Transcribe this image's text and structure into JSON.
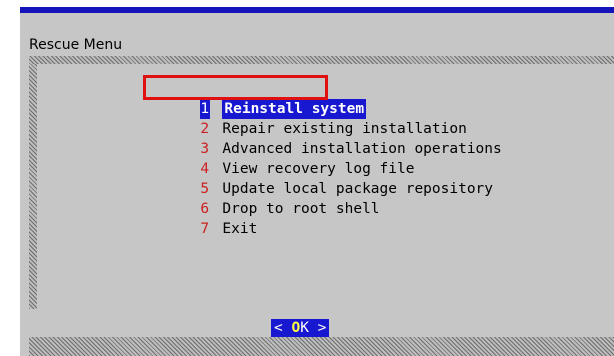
{
  "dialog": {
    "title": "Rescue Menu"
  },
  "menu": {
    "selected_index": 0,
    "items": [
      {
        "number": "1",
        "label": "Reinstall system"
      },
      {
        "number": "2",
        "label": "Repair existing installation"
      },
      {
        "number": "3",
        "label": "Advanced installation operations"
      },
      {
        "number": "4",
        "label": "View recovery log file"
      },
      {
        "number": "5",
        "label": "Update local package repository"
      },
      {
        "number": "6",
        "label": "Drop to root shell"
      },
      {
        "number": "7",
        "label": "Exit"
      }
    ]
  },
  "button": {
    "left_bracket": "< ",
    "hotkey": "O",
    "rest": "K",
    "right_bracket": " >"
  },
  "colors": {
    "title_bar": "#1414b8",
    "dialog_background": "#c6c6c6",
    "selection": "#1818d0",
    "menu_number": "#cc2020",
    "annotation_box": "#e01010"
  }
}
